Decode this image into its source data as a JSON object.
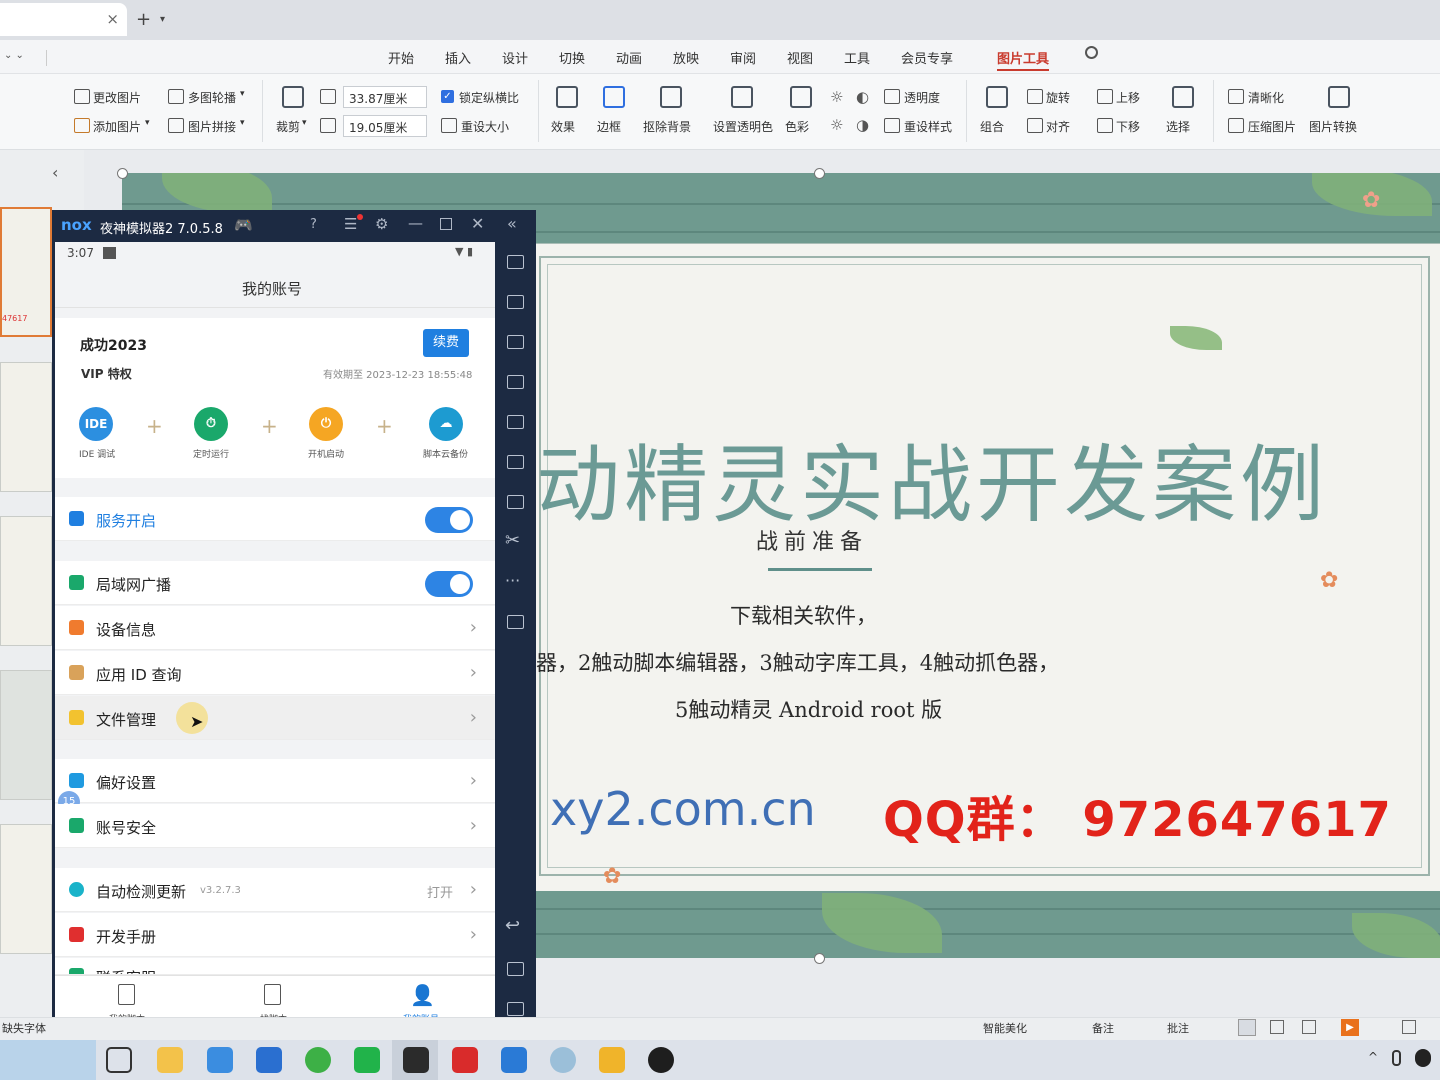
{
  "titlebar": {
    "new_tab_symbol": "+",
    "close_symbol": "×",
    "dropdown_symbol": "⌄"
  },
  "menu": {
    "items": [
      "开始",
      "插入",
      "设计",
      "切换",
      "动画",
      "放映",
      "审阅",
      "视图",
      "工具",
      "会员专享",
      "图片工具"
    ],
    "active": "图片工具"
  },
  "ribbon": {
    "change_image": "更改图片",
    "add_image": "添加图片",
    "multi_carousel": "多图轮播",
    "image_splice": "图片拼接",
    "crop": "裁剪",
    "width_value": "33.87厘米",
    "height_value": "19.05厘米",
    "lock_ratio": "锁定纵横比",
    "reset_size": "重设大小",
    "effects": "效果",
    "border": "边框",
    "remove_bg": "抠除背景",
    "set_transparent": "设置透明色",
    "color": "色彩",
    "transparency": "透明度",
    "reset_style": "重设样式",
    "group": "组合",
    "rotate": "旋转",
    "align": "对齐",
    "move_up": "上移",
    "move_down": "下移",
    "select": "选择",
    "sharpen": "清晰化",
    "compress": "压缩图片",
    "convert": "图片转换"
  },
  "slide": {
    "title": "动精灵实战开发案例",
    "subtitle": "战前准备",
    "line1": "下载相关软件，",
    "line2": "器，2触动脚本编辑器，3触动字库工具，4触动抓色器，",
    "line3": "5触动精灵 Android root 版",
    "url": "xy2.com.cn",
    "qq": "QQ群：  972647617"
  },
  "thumb_partial_text": "47617",
  "emulator": {
    "logo": "nox",
    "title": "夜神模拟器2 7.0.5.8"
  },
  "phone": {
    "time": "3:07",
    "page_title": "我的账号",
    "username": "成功2023",
    "renew_button": "续费",
    "vip_label": "VIP 特权",
    "expiry": "有效期至 2023-12-23 18:55:48",
    "quick": [
      {
        "icon_text": "IDE",
        "label": "IDE 调试",
        "color": "#2c8fe0"
      },
      {
        "icon_text": "⏱",
        "label": "定时运行",
        "color": "#1aa86b"
      },
      {
        "icon_text": "⏻",
        "label": "开机启动",
        "color": "#f5a623"
      },
      {
        "icon_text": "☁",
        "label": "脚本云备份",
        "color": "#1d9bd1"
      }
    ],
    "service_on": "服务开启",
    "lan_broadcast": "局域网广播",
    "device_info": "设备信息",
    "app_id_query": "应用 ID 查询",
    "file_manage": "文件管理",
    "preferences": "偏好设置",
    "account_security": "账号安全",
    "auto_update": "自动检测更新",
    "version": "v3.2.7.3",
    "open_label": "打开",
    "dev_manual": "开发手册",
    "contact_partial": "联系客服",
    "tabs": [
      "我的脚本",
      "找脚本",
      "我的账号"
    ],
    "badge": "15"
  },
  "statusbar": {
    "missing_font": "缺失字体",
    "smart_beautify": "智能美化",
    "notes": "备注",
    "comments": "批注"
  }
}
